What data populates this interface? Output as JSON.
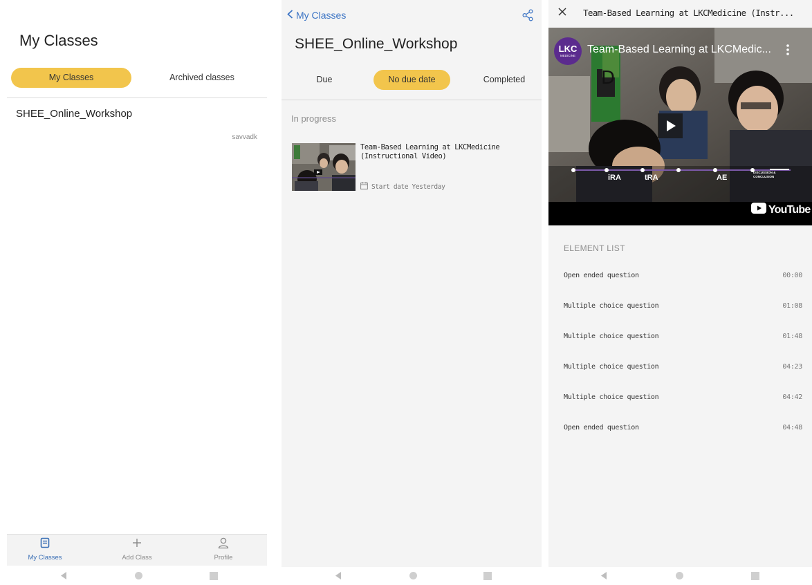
{
  "panel1": {
    "title": "My Classes",
    "tabs": {
      "active": "My Classes",
      "archived": "Archived classes"
    },
    "class_item": {
      "name": "SHEE_Online_Workshop",
      "owner": "savvadk"
    },
    "bottom_nav": [
      {
        "label": "My Classes",
        "icon": "book-icon"
      },
      {
        "label": "Add Class",
        "icon": "plus-icon"
      },
      {
        "label": "Profile",
        "icon": "profile-icon"
      }
    ]
  },
  "panel2": {
    "back_label": "My Classes",
    "title": "SHEE_Online_Workshop",
    "tabs": {
      "due": "Due",
      "no_due": "No due date",
      "completed": "Completed"
    },
    "section_label": "In progress",
    "activity": {
      "title": "Team-Based Learning at LKCMedicine (Instructional Video)",
      "date": "Start date Yesterday"
    }
  },
  "panel3": {
    "header_title": "Team-Based Learning at LKCMedicine (Instr...",
    "video": {
      "channel_logo": "LKC",
      "channel_logo_sub": "MEDICINE",
      "title": "Team-Based Learning at LKCMedic...",
      "board_letter": "D",
      "stages": [
        "iRA",
        "tRA",
        "AE",
        "Discussion & Conclusion"
      ],
      "brand": "YouTube"
    },
    "element_list_label": "ELEMENT LIST",
    "elements": [
      {
        "name": "Open ended question",
        "time": "00:00"
      },
      {
        "name": "Multiple choice question",
        "time": "01:08"
      },
      {
        "name": "Multiple choice question",
        "time": "01:48"
      },
      {
        "name": "Multiple choice question",
        "time": "04:23"
      },
      {
        "name": "Multiple choice question",
        "time": "04:42"
      },
      {
        "name": "Open ended question",
        "time": "04:48"
      }
    ]
  },
  "colors": {
    "accent_yellow": "#f2c54c",
    "link_blue": "#3a73c4",
    "youtube_red": "#ff0000"
  }
}
